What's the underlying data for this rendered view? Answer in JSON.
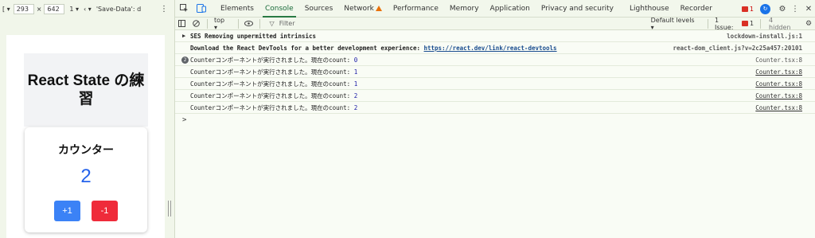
{
  "device_toolbar": {
    "width": "293",
    "height": "642",
    "dpr": "1",
    "network": "'Save-Data': d"
  },
  "app": {
    "title": "React State の練習",
    "counter_heading": "カウンター",
    "count": "2",
    "inc_label": "+1",
    "dec_label": "-1"
  },
  "devtools": {
    "tabs": [
      "Elements",
      "Console",
      "Sources",
      "Network",
      "Performance",
      "Memory",
      "Application",
      "Privacy and security",
      "Lighthouse",
      "Recorder"
    ],
    "active_tab": "Console",
    "issues_badge": "1",
    "toolbar": {
      "context": "top",
      "filter_placeholder": "Filter",
      "levels": "Default levels",
      "issues_label": "1 Issue:",
      "issues_count": "1",
      "hidden": "4 hidden"
    },
    "logs": [
      {
        "type": "group",
        "text": "SES Removing unpermitted intrinsics",
        "source": "lockdown-install.js:1"
      },
      {
        "type": "info",
        "text_prefix": "Download the React DevTools for a better development experience: ",
        "link": "https://react.dev/link/react-devtools",
        "source": "react-dom_client.js?v=2c25a457:20101"
      },
      {
        "type": "repeat",
        "badge": "2",
        "text": "Counterコンポーネントが実行されました。現在のcount: ",
        "value": "0",
        "source": "Counter.tsx:8"
      },
      {
        "type": "log",
        "text": "Counterコンポーネントが実行されました。現在のcount: ",
        "value": "1",
        "source": "Counter.tsx:8"
      },
      {
        "type": "log",
        "text": "Counterコンポーネントが実行されました。現在のcount: ",
        "value": "1",
        "source": "Counter.tsx:8"
      },
      {
        "type": "log",
        "text": "Counterコンポーネントが実行されました。現在のcount: ",
        "value": "2",
        "source": "Counter.tsx:8"
      },
      {
        "type": "log",
        "text": "Counterコンポーネントが実行されました。現在のcount: ",
        "value": "2",
        "source": "Counter.tsx:8"
      }
    ],
    "prompt": ">"
  }
}
